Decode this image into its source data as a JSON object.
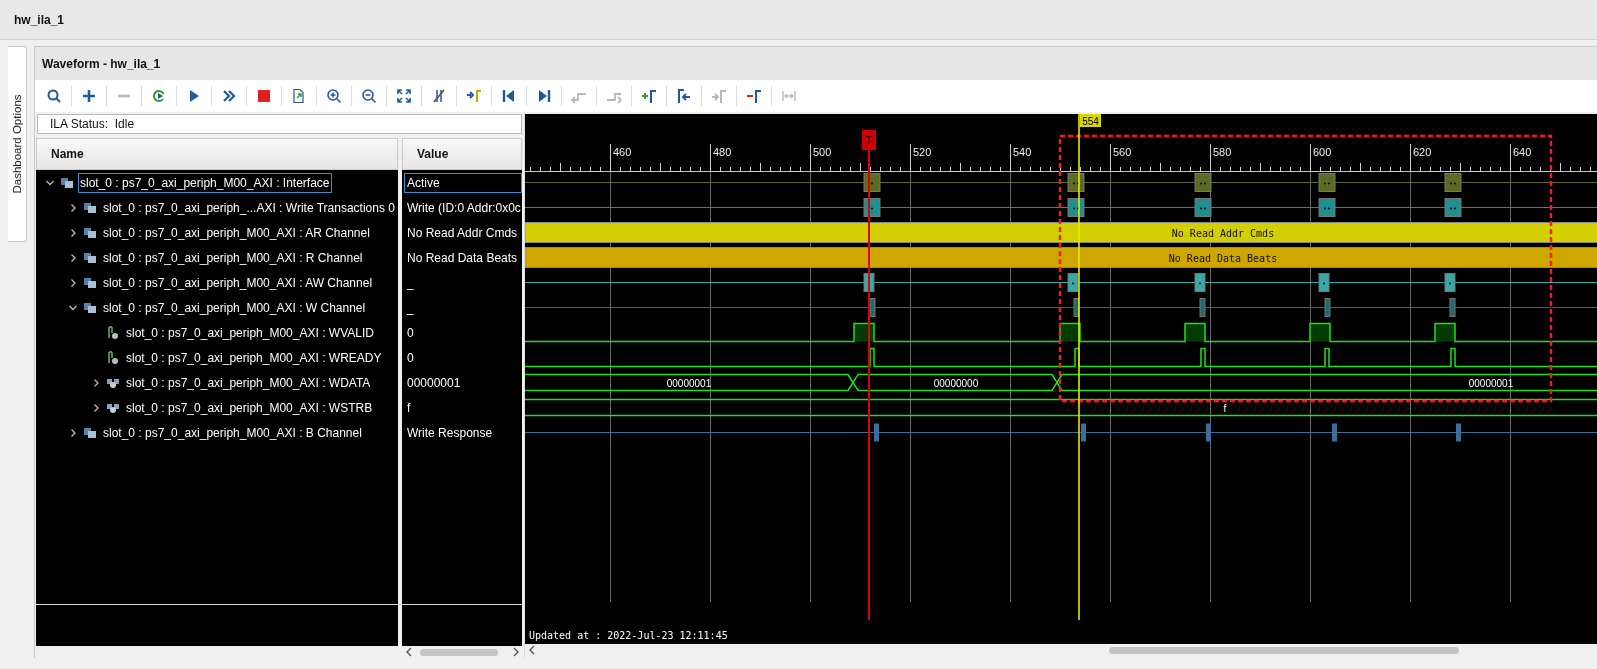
{
  "window": {
    "title": "hw_ila_1"
  },
  "side_tab": {
    "label": "Dashboard Options"
  },
  "panel": {
    "title": "Waveform - hw_ila_1"
  },
  "toolbar": [
    {
      "kind": "search",
      "disabled": false
    },
    {
      "kind": "add",
      "disabled": false
    },
    {
      "kind": "remove",
      "disabled": true
    },
    {
      "kind": "refresh",
      "disabled": false
    },
    {
      "kind": "run",
      "disabled": false
    },
    {
      "kind": "run-immediate",
      "disabled": false
    },
    {
      "kind": "stop",
      "disabled": false
    },
    {
      "kind": "export",
      "disabled": false
    },
    {
      "kind": "zoom-in",
      "disabled": false
    },
    {
      "kind": "zoom-out",
      "disabled": false
    },
    {
      "kind": "zoom-fit",
      "disabled": false
    },
    {
      "kind": "cursor-off",
      "disabled": false
    },
    {
      "kind": "goto-cursor",
      "disabled": false
    },
    {
      "kind": "go-start",
      "disabled": false
    },
    {
      "kind": "go-end",
      "disabled": false
    },
    {
      "kind": "prev-transition",
      "disabled": true
    },
    {
      "kind": "next-transition",
      "disabled": true
    },
    {
      "kind": "add-marker",
      "disabled": false
    },
    {
      "kind": "prev-marker",
      "disabled": false
    },
    {
      "kind": "next-marker",
      "disabled": true
    },
    {
      "kind": "delete-marker",
      "disabled": false
    },
    {
      "kind": "distance",
      "disabled": true
    }
  ],
  "status": "ILA Status:  Idle",
  "columns": [
    "Name",
    "Value"
  ],
  "rows": [
    {
      "kind": "interface",
      "name": "slot_0 : ps7_0_axi_periph_M00_AXI : Interface",
      "value": "Active",
      "expanded": true,
      "selected": true,
      "children": [
        {
          "kind": "interface",
          "name": "slot_0 : ps7_0_axi_periph_...AXI : Write Transactions 0",
          "value": "Write (ID:0 Addr:0x0c",
          "expanded": false,
          "selected": false
        },
        {
          "kind": "interface",
          "name": "slot_0 : ps7_0_axi_periph_M00_AXI : AR Channel",
          "value": "No Read Addr Cmds",
          "expanded": false,
          "selected": false
        },
        {
          "kind": "interface",
          "name": "slot_0 : ps7_0_axi_periph_M00_AXI : R Channel",
          "value": "No Read Data Beats",
          "expanded": false,
          "selected": false
        },
        {
          "kind": "interface",
          "name": "slot_0 : ps7_0_axi_periph_M00_AXI : AW Channel",
          "value": "_",
          "expanded": false,
          "selected": false
        },
        {
          "kind": "interface",
          "name": "slot_0 : ps7_0_axi_periph_M00_AXI : W Channel",
          "value": "_",
          "expanded": true,
          "selected": false,
          "children": [
            {
              "kind": "bit",
              "name": "slot_0 : ps7_0_axi_periph_M00_AXI : WVALID",
              "value": "0",
              "selected": false
            },
            {
              "kind": "bit",
              "name": "slot_0 : ps7_0_axi_periph_M00_AXI : WREADY",
              "value": "0",
              "selected": false
            },
            {
              "kind": "bus",
              "name": "slot_0 : ps7_0_axi_periph_M00_AXI : WDATA",
              "value": "00000001",
              "expanded": false,
              "selected": false
            },
            {
              "kind": "bus",
              "name": "slot_0 : ps7_0_axi_periph_M00_AXI : WSTRB",
              "value": "f",
              "expanded": false,
              "selected": false
            }
          ]
        },
        {
          "kind": "interface",
          "name": "slot_0 : ps7_0_axi_periph_M00_AXI : B Channel",
          "value": "Write Response",
          "expanded": false,
          "selected": false
        }
      ]
    }
  ],
  "ruler": {
    "labels": [
      "460",
      "480",
      "500",
      "520",
      "540",
      "560",
      "580",
      "600",
      "620",
      "640"
    ]
  },
  "trigger": {
    "label": "T"
  },
  "cursor": {
    "label": "554"
  },
  "waves": [
    {
      "kind": "transaction",
      "color": "#5b6b23"
    },
    {
      "kind": "transaction",
      "color": "#1f8f8f"
    },
    {
      "kind": "band",
      "color": "#d4cf00",
      "text": "No Read Addr Cmds"
    },
    {
      "kind": "band",
      "color": "#cfa600",
      "text": "No Read Data Beats"
    },
    {
      "kind": "beat",
      "color": "#3aa8a8"
    },
    {
      "kind": "strobe",
      "color": "#1d6b6b"
    },
    {
      "kind": "valid"
    },
    {
      "kind": "ready"
    },
    {
      "kind": "bus",
      "segments": [
        "00000001",
        "00000000",
        "00000001"
      ]
    },
    {
      "kind": "bus",
      "segments": [
        "f"
      ]
    },
    {
      "kind": "response",
      "color": "#3d6e99"
    }
  ],
  "updated": "Updated at : 2022-Jul-23 12:11:45"
}
